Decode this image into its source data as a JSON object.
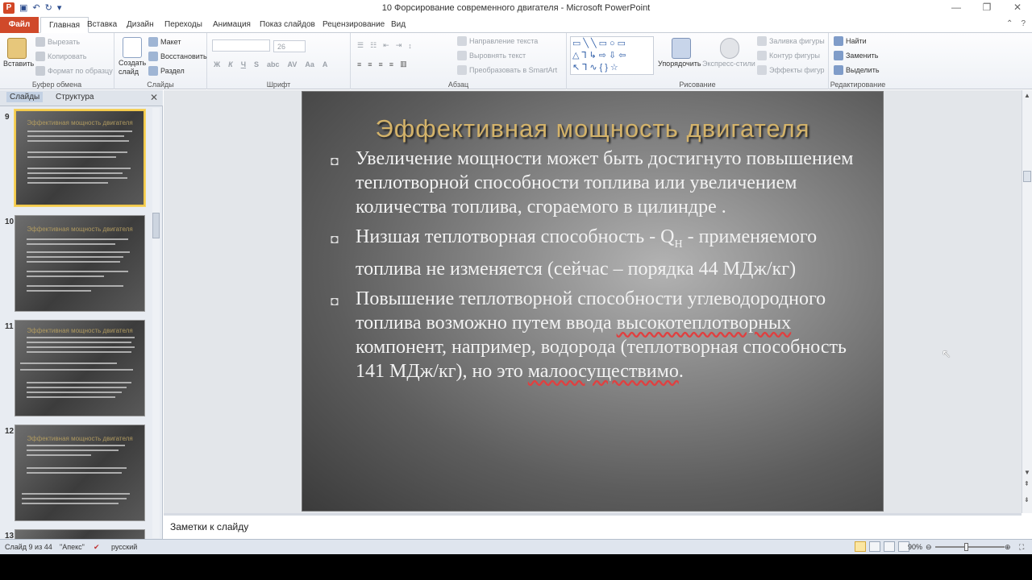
{
  "window": {
    "title": "10 Форсирование современного двигателя - Microsoft PowerPoint",
    "app_icon": "P",
    "controls": [
      "—",
      "❐",
      "✕"
    ]
  },
  "quick_access": [
    "save-icon",
    "undo-icon",
    "redo-icon",
    "customize-icon"
  ],
  "tabs": {
    "file": "Файл",
    "items": [
      "Главная",
      "Вставка",
      "Дизайн",
      "Переходы",
      "Анимация",
      "Показ слайдов",
      "Рецензирование",
      "Вид"
    ],
    "active_index": 0
  },
  "ribbon": {
    "clipboard": {
      "paste": "Вставить",
      "cut": "Вырезать",
      "copy": "Копировать",
      "format_painter": "Формат по образцу",
      "label": "Буфер обмена"
    },
    "slides": {
      "new_slide": "Создать слайд",
      "layout": "Макет",
      "reset": "Восстановить",
      "section": "Раздел",
      "label": "Слайды"
    },
    "font": {
      "size": "26",
      "label": "Шрифт"
    },
    "paragraph": {
      "text_direction": "Направление текста",
      "align_text": "Выровнять текст",
      "smartart": "Преобразовать в SmartArt",
      "label": "Абзац"
    },
    "drawing": {
      "arrange": "Упорядочить",
      "quick_styles": "Экспресс-стили",
      "shape_fill": "Заливка фигуры",
      "shape_outline": "Контур фигуры",
      "shape_effects": "Эффекты фигур",
      "label": "Рисование"
    },
    "editing": {
      "find": "Найти",
      "replace": "Заменить",
      "select": "Выделить",
      "label": "Редактирование"
    }
  },
  "left_panel": {
    "tabs": [
      "Слайды",
      "Структура"
    ],
    "thumbnails": [
      {
        "number": "9",
        "title": "Эффективная мощность двигателя"
      },
      {
        "number": "10",
        "title": "Эффективная мощность двигателя"
      },
      {
        "number": "11",
        "title": "Эффективная мощность двигателя"
      },
      {
        "number": "12",
        "title": "Эффективная мощность двигателя"
      },
      {
        "number": "13",
        "title": ""
      }
    ]
  },
  "slide": {
    "title": "Эффективная мощность двигателя",
    "bullet_glyph": "◘",
    "bullets": {
      "b1": "Увеличение мощности может быть достигнуто повышением теплотворной способности топлива или увеличением количества топлива, сгораемого в цилиндре .",
      "b2_pre": "Низшая теплотворная способность - Q",
      "b2_sub": "Н",
      "b2_post": " - применяемого топлива не изменяется (сейчас – порядка 44 МДж/кг)",
      "b3_pre": "Повышение теплотворной способности углеводородного топлива возможно путем ввода ",
      "b3_u1": "высокотеплотворных",
      "b3_mid": " компонент, например, водорода (теплотворная способность 141 МДж/кг), но это ",
      "b3_u2": "малоосуществимо",
      "b3_end": "."
    }
  },
  "notes": {
    "placeholder": "Заметки к слайду"
  },
  "status": {
    "slide_info": "Слайд 9 из 44",
    "theme": "\"Апекс\"",
    "language": "русский",
    "zoom": "90%"
  }
}
